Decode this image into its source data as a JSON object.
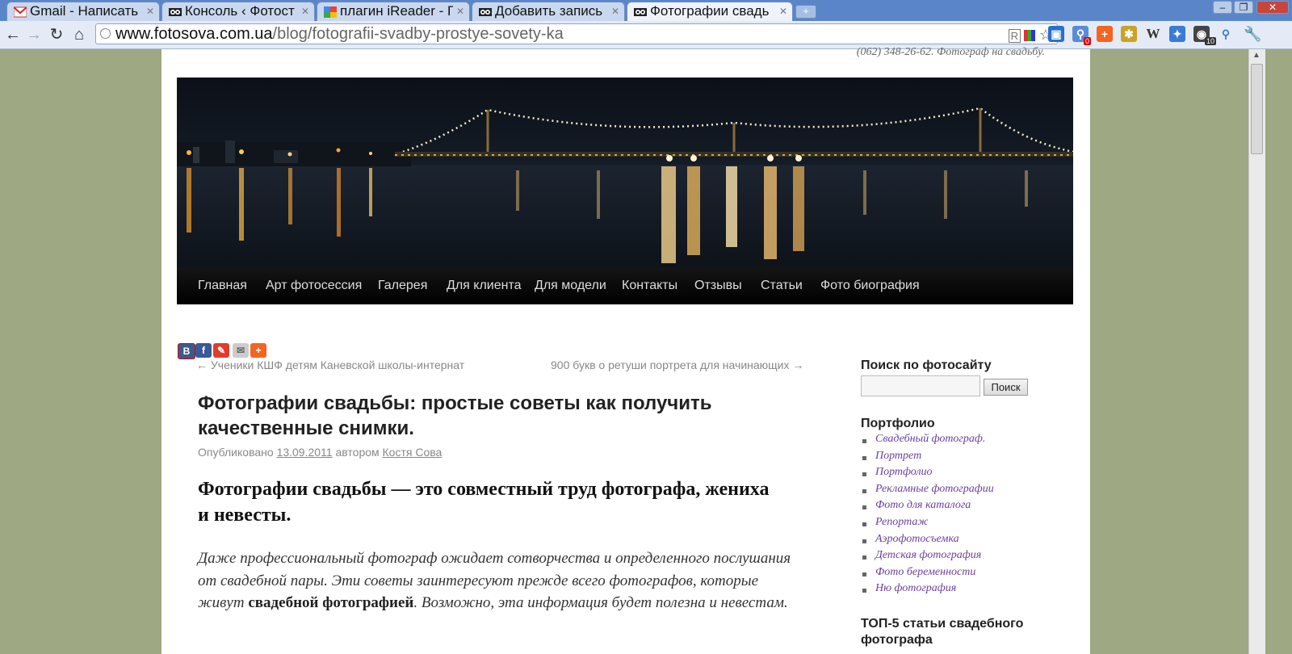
{
  "browser": {
    "tabs": [
      {
        "label": "Gmail - Написать",
        "icon": "gmail-icon"
      },
      {
        "label": "Консоль ‹ Фотост",
        "icon": "owl-icon"
      },
      {
        "label": "плагин iReader - Г",
        "icon": "google-icon"
      },
      {
        "label": "Добавить запись",
        "icon": "owl-icon"
      },
      {
        "label": "Фотографии свадь",
        "icon": "owl-icon",
        "active": true
      }
    ],
    "new_tab": "+",
    "url_domain": "www.fotosova.com.ua",
    "url_path": "/blog/fotografii-svadby-prostye-sovety-ka",
    "extension_badges": [
      "0",
      "10"
    ]
  },
  "site": {
    "tagline": "(062) 348-26-62. Фотограф на свадьбу.",
    "nav": [
      "Главная",
      "Арт фотосессия",
      "Галерея",
      "Для клиента",
      "Для модели",
      "Контакты",
      "Отзывы",
      "Статьи",
      "Фото биография"
    ]
  },
  "share": [
    "B",
    "f",
    "✎",
    "✉",
    "+"
  ],
  "post": {
    "prev_link": "← Ученики КШФ детям Каневской школы-интернат",
    "next_link": "900 букв о ретуши портрета для начинающих →",
    "title": "Фотографии свадьбы: простые советы как получить качественные снимки.",
    "meta_prefix": "Опубликовано",
    "date": "13.09.2011",
    "meta_by": "автором",
    "author": "Костя Сова",
    "lead": "Фотографии свадьбы — это совместный труд фотографа, жениха и невесты.",
    "para_start": "Даже профессиональный фотограф ожидает сотворчества и определенного послушания от свадебной пары. Эти советы заинтересуют прежде всего фотографов, которые живут ",
    "para_bold": "свадебной фотографией",
    "para_end": ". Возможно, эта информация будет полезна и невестам."
  },
  "sidebar": {
    "search_title": "Поиск по фотосайту",
    "search_button": "Поиск",
    "portfolio_title": "Портфолио",
    "portfolio_items": [
      "Свадебный фотограф.",
      "Портрет",
      "Портфолио",
      "Рекламные фотографии",
      "Фото для каталога",
      "Репортаж",
      "Аэрофотосъемка",
      "Детская фотография",
      "Фото беременности",
      "Ню фотография"
    ],
    "top5_title": "ТОП-5 статьи свадебного фотографа"
  },
  "colors": {
    "page_bg": "#9ea882",
    "link_purple": "#6b3fa0",
    "nav_bg": "#000000"
  }
}
